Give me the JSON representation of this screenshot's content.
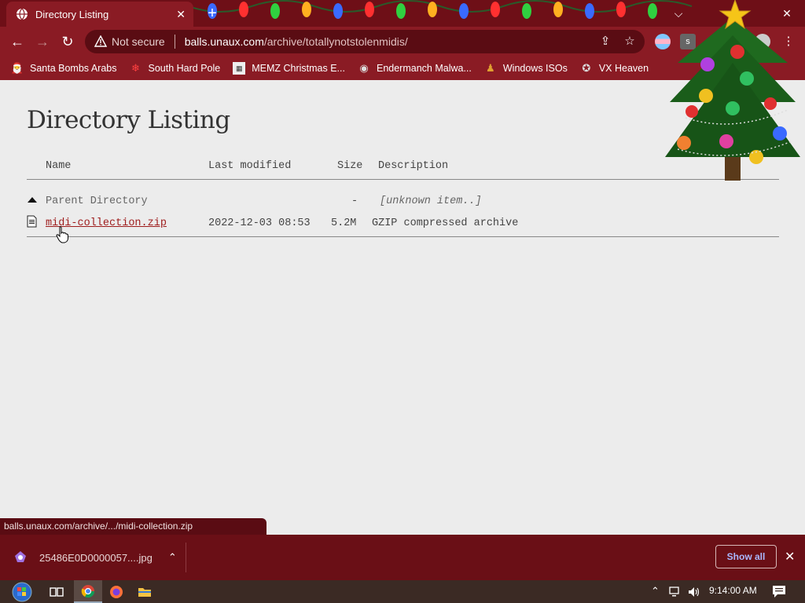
{
  "tab": {
    "title": "Directory Listing",
    "close": "✕",
    "new_tab": "+"
  },
  "window_controls": {
    "dropdown": "⌵",
    "minimize": "—",
    "restore": "❐",
    "close": "✕"
  },
  "toolbar": {
    "back": "←",
    "forward": "→",
    "reload": "↻",
    "not_secure": "Not secure",
    "url_domain": "balls.unaux.com",
    "url_path": "/archive/totallynotstolenmidis/",
    "share": "⇪",
    "star": "☆",
    "menu": "⋮"
  },
  "bookmarks": [
    {
      "label": "Santa Bombs Arabs",
      "icon": "santa-icon"
    },
    {
      "label": "South Hard Pole",
      "icon": "snowflake-icon"
    },
    {
      "label": "MEMZ Christmas E...",
      "icon": "memz-icon"
    },
    {
      "label": "Endermanch Malwa...",
      "icon": "raccoon-icon"
    },
    {
      "label": "Windows ISOs",
      "icon": "figure-icon"
    },
    {
      "label": "VX Heaven",
      "icon": "vx-icon"
    }
  ],
  "page": {
    "title": "Directory Listing",
    "columns": {
      "name": "Name",
      "modified": "Last modified",
      "size": "Size",
      "description": "Description"
    },
    "rows": [
      {
        "name": "Parent Directory",
        "modified": "",
        "size": "-",
        "description": "[unknown item..]",
        "icon": "up-arrow-icon"
      },
      {
        "name": "midi-collection.zip",
        "modified": "2022-12-03 08:53",
        "size": "5.2M",
        "description": "GZIP compressed archive",
        "icon": "file-icon"
      }
    ]
  },
  "status_url": "balls.unaux.com/archive/.../midi-collection.zip",
  "downloads": {
    "item_name": "25486E0D0000057....jpg",
    "chevron": "⌃",
    "show_all": "Show all",
    "close": "✕"
  },
  "taskbar": {
    "clock": "9:14:00 AM",
    "tray_chevron": "⌃"
  },
  "colors": {
    "chrome_dark": "#6e0f17",
    "chrome": "#8a1b24",
    "link": "#9e1c1c",
    "page_bg": "#ececec"
  }
}
